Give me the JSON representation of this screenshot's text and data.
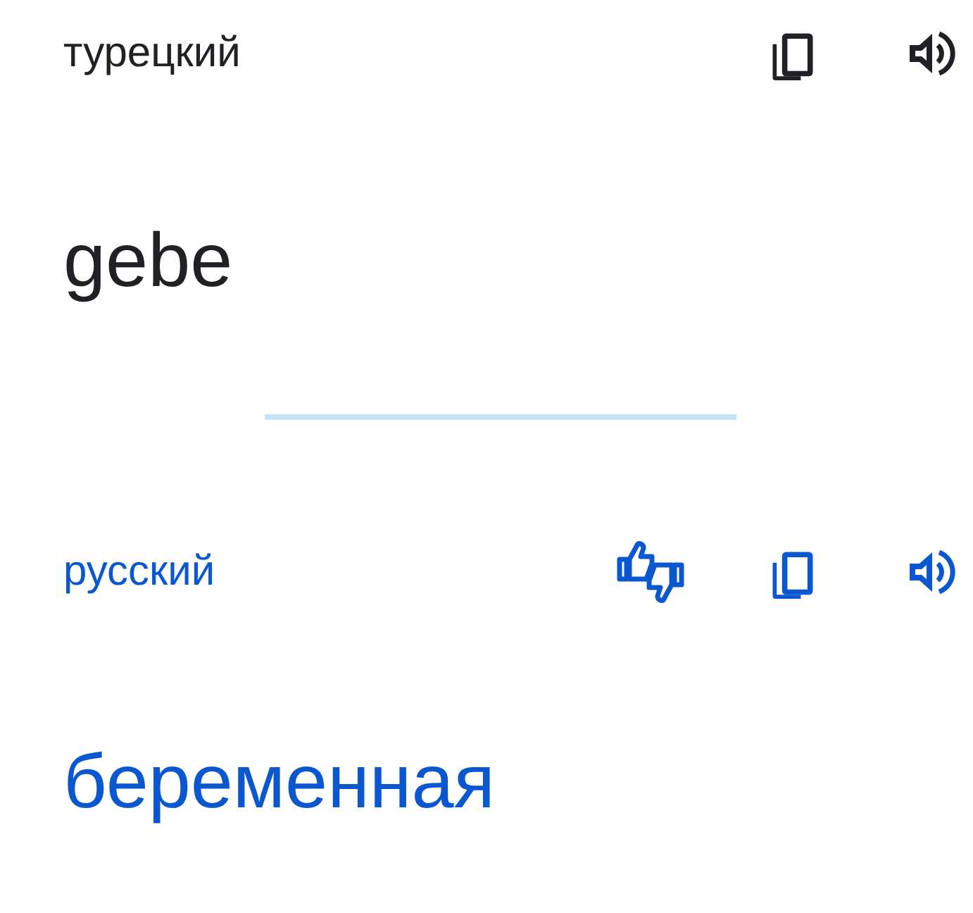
{
  "source": {
    "language": "турецкий",
    "text": "gebe"
  },
  "target": {
    "language": "русский",
    "text": "беременная"
  }
}
